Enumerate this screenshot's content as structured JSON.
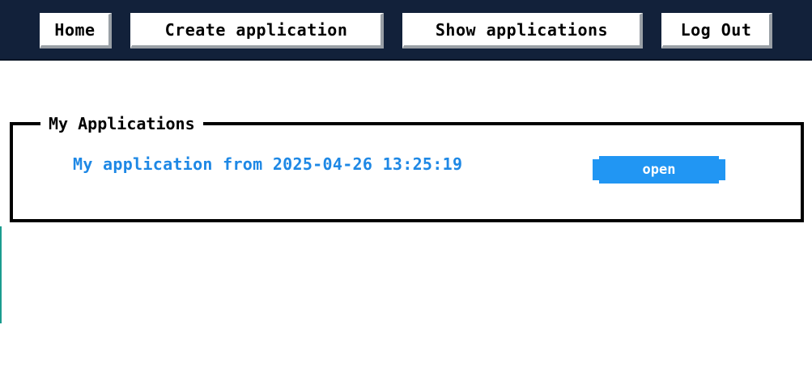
{
  "nav": {
    "items": [
      {
        "label": "Home"
      },
      {
        "label": "Create application"
      },
      {
        "label": "Show applications"
      },
      {
        "label": "Log Out"
      }
    ]
  },
  "applications": {
    "legend": "My Applications",
    "items": [
      {
        "title": "My application from 2025-04-26 13:25:19",
        "action_label": "open"
      }
    ]
  },
  "colors": {
    "nav_background": "#12213a",
    "link": "#1e88e5",
    "button": "#2196f3"
  }
}
